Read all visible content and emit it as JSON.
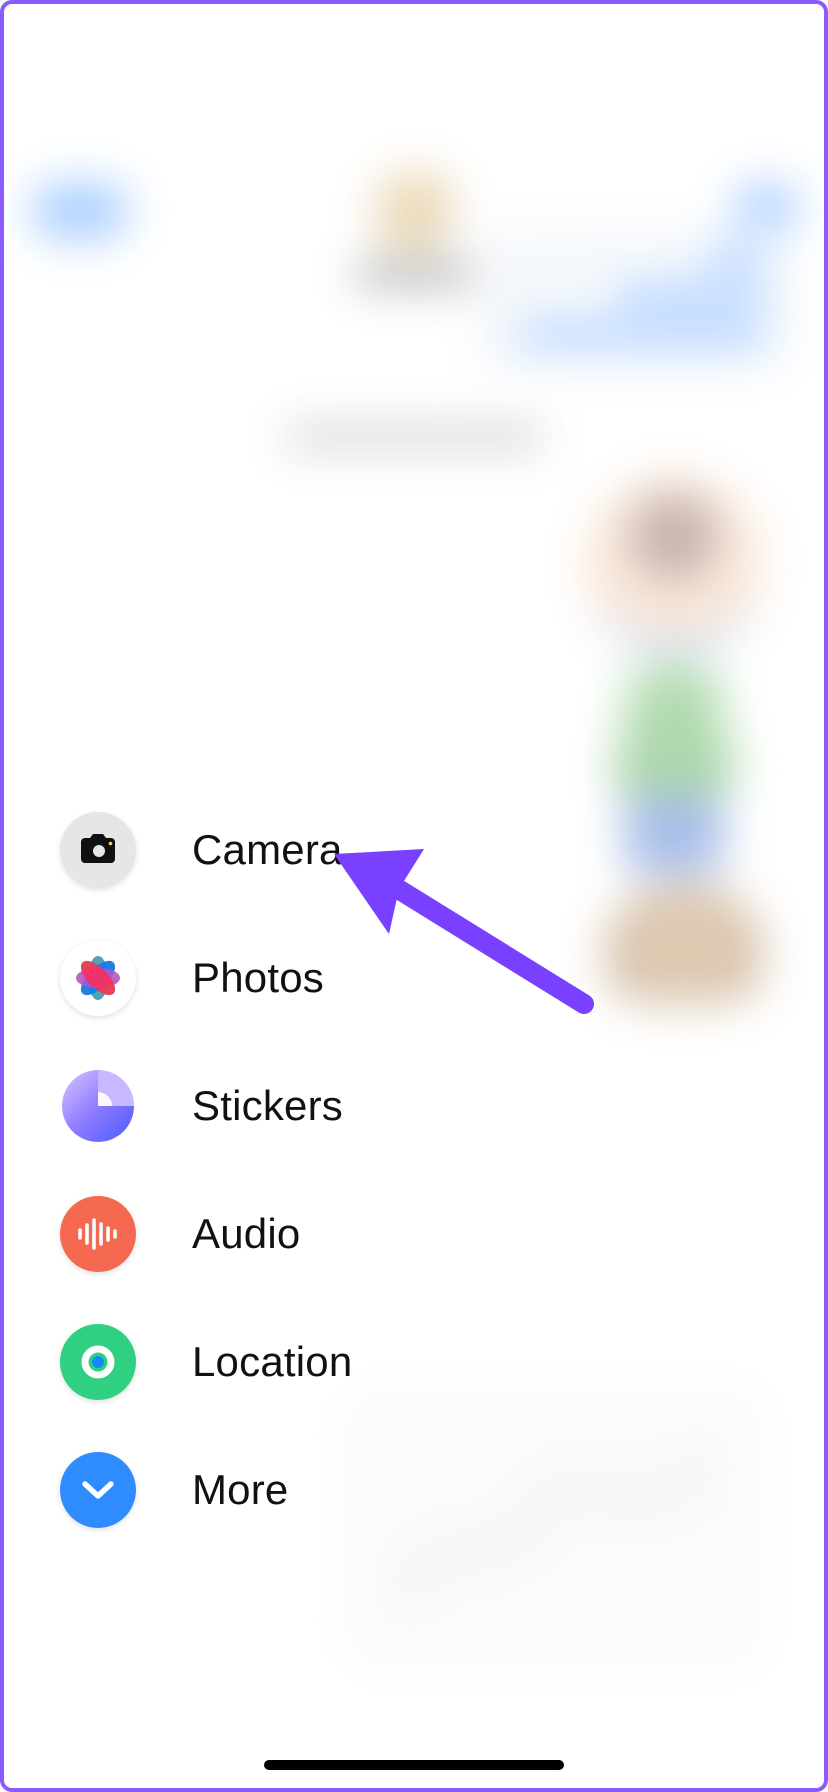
{
  "menu": {
    "items": [
      {
        "label": "Camera",
        "icon": "camera-icon"
      },
      {
        "label": "Photos",
        "icon": "photos-icon"
      },
      {
        "label": "Stickers",
        "icon": "stickers-icon"
      },
      {
        "label": "Audio",
        "icon": "audio-icon"
      },
      {
        "label": "Location",
        "icon": "location-icon"
      },
      {
        "label": "More",
        "icon": "more-chevron-icon"
      }
    ]
  },
  "annotation": {
    "target": "Camera",
    "arrow_color": "#7a40ff"
  },
  "colors": {
    "frame_border": "#8a5cff",
    "accent_blue": "#2f8cff",
    "audio_coral": "#f4694f",
    "location_green": "#2fd082"
  }
}
